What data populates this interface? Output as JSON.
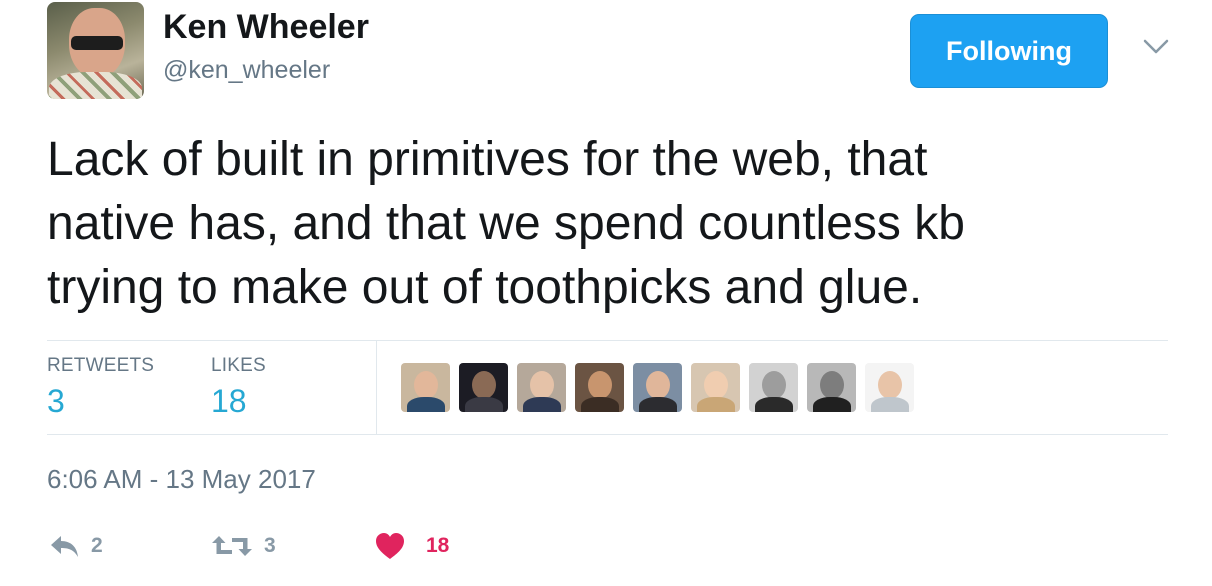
{
  "author": {
    "name": "Ken Wheeler",
    "handle": "@ken_wheeler"
  },
  "follow_button": {
    "label": "Following"
  },
  "tweet": {
    "text": "Lack of built in primitives for the web, that\nnative has, and that we spend countless kb\ntrying to make out of toothpicks and glue."
  },
  "stats": {
    "retweets_label": "RETWEETS",
    "retweets_count": "3",
    "likes_label": "LIKES",
    "likes_count": "18"
  },
  "timestamp": "6:06 AM - 13 May 2017",
  "actions": {
    "reply_count": "2",
    "retweet_count": "3",
    "like_count": "18"
  },
  "colors": {
    "accent": "#1da1f2",
    "like": "#e0245e",
    "muted": "#657786"
  },
  "icons": {
    "reply": "reply-icon",
    "retweet": "retweet-icon",
    "like": "heart-icon",
    "menu": "chevron-down-icon"
  }
}
